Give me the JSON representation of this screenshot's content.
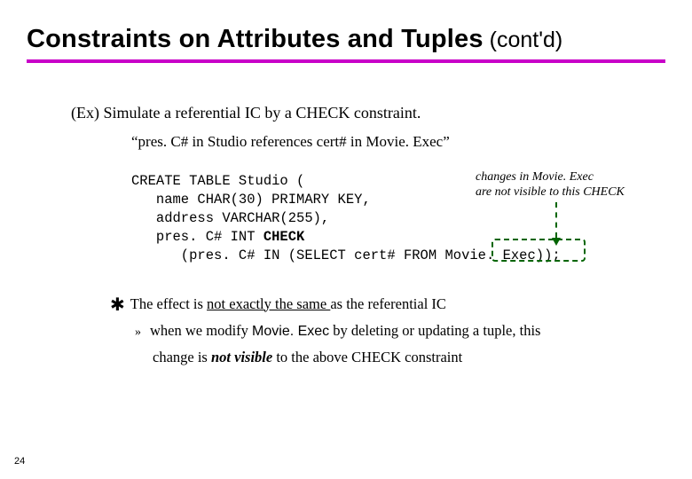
{
  "page_number": "24",
  "title": {
    "main": "Constraints on Attributes and Tuples",
    "tail": " (cont'd)"
  },
  "ex": {
    "prefix": "(Ex) ",
    "text": "Simulate a referential IC by a CHECK constraint."
  },
  "quote": "“pres. C# in Studio references cert# in Movie. Exec”",
  "code": {
    "l1a": "CREATE TABLE Studio (",
    "l2": "   name CHAR(30) PRIMARY KEY,",
    "l3": "   address VARCHAR(255),",
    "l4a": "   pres. C# INT ",
    "l4b": "CHECK",
    "l5a": "      (pres. C# IN (SELECT cert# FROM ",
    "l5b": "Movie. Exec",
    "l5c": "));"
  },
  "annot": {
    "l1": "changes in Movie. Exec",
    "l2": "are not visible to this CHECK"
  },
  "note": {
    "p1a": "The effect is ",
    "p1b": "not exactly the same ",
    "p1c": "as the referential IC",
    "p2a": "when we modify ",
    "p2b": "Movie. Exec",
    "p2c": " by deleting or updating a tuple, this",
    "p3a": "change is ",
    "p3b": "not visible",
    "p3c": " to the above CHECK constraint"
  }
}
